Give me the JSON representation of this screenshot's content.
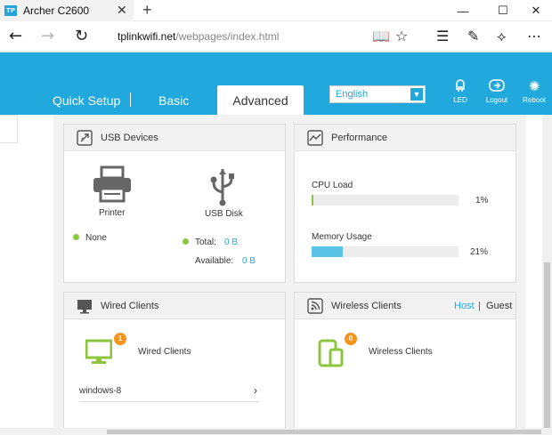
{
  "browser": {
    "tab_title": "Archer C2600",
    "favicon_text": "TP",
    "url_host": "tplinkwifi.net",
    "url_path": "/webpages/index.html"
  },
  "router_nav": {
    "tabs": [
      "Quick Setup",
      "Basic",
      "Advanced"
    ],
    "active_tab": "Advanced",
    "language": "English",
    "buttons": [
      "LED",
      "Logout",
      "Reboot"
    ]
  },
  "usb_devices": {
    "title": "USB Devices",
    "printer_label": "Printer",
    "printer_status": "None",
    "disk_label": "USB Disk",
    "total_label": "Total:",
    "total_value": "0 B",
    "available_label": "Available:",
    "available_value": "0 B"
  },
  "performance": {
    "title": "Performance",
    "cpu_label": "CPU Load",
    "cpu_value": "1%",
    "cpu_fraction": 0.01,
    "memory_label": "Memory Usage",
    "memory_value": "21%",
    "memory_fraction": 0.21
  },
  "wired_clients": {
    "title": "Wired Clients",
    "count": "1",
    "label": "Wired Clients",
    "items": [
      "windows-8"
    ]
  },
  "wireless_clients": {
    "title": "Wireless Clients",
    "count": "0",
    "label": "Wireless Clients",
    "host_label": "Host",
    "separator": "|",
    "guest_label": "Guest"
  },
  "colors": {
    "brand_blue": "#21a8dc",
    "status_green": "#8cc63f",
    "badge_orange": "#f7941d",
    "bar_fill": "#5bc4e6"
  }
}
